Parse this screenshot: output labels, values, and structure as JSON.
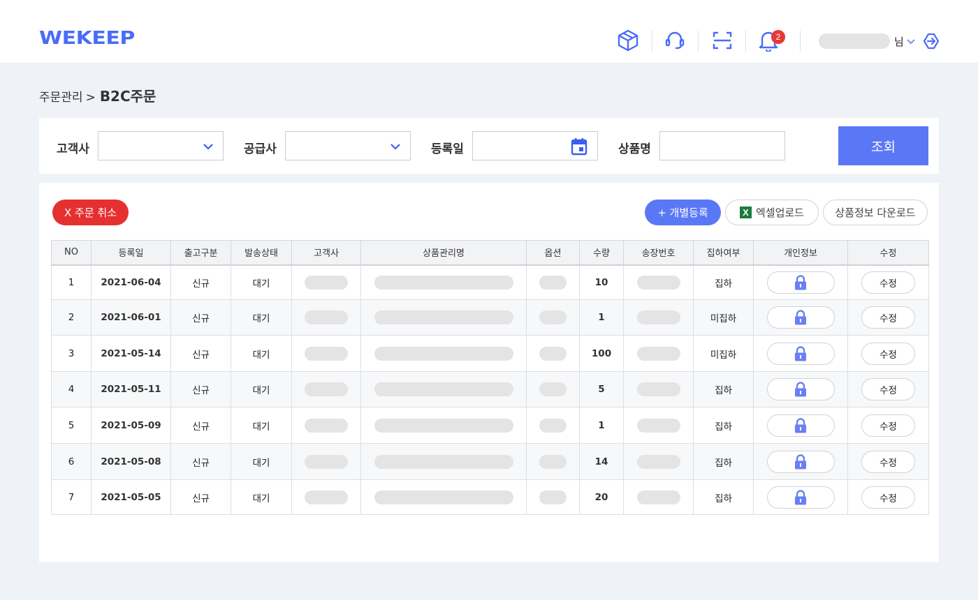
{
  "header": {
    "logo": "WEKEEP",
    "notification_count": "2",
    "user_suffix": "님"
  },
  "breadcrumb": {
    "parent": "주문관리",
    "separator": ">",
    "current": "B2C주문"
  },
  "filter": {
    "customer_label": "고객사",
    "supplier_label": "공급사",
    "date_label": "등록일",
    "product_label": "상품명",
    "search_button": "조회"
  },
  "actions": {
    "cancel_order": "X 주문 취소",
    "add_single": "+ 개별등록",
    "excel_upload": "엑셀업로드",
    "excel_icon": "X",
    "download_product_info": "상품정보 다운로드"
  },
  "table": {
    "columns": [
      "NO",
      "등록일",
      "출고구분",
      "발송상태",
      "고객사",
      "상품관리명",
      "옵션",
      "수량",
      "송장번호",
      "집하여부",
      "개인정보",
      "수정"
    ],
    "rows": [
      {
        "no": "1",
        "date": "2021-06-04",
        "type": "신규",
        "status": "대기",
        "qty": "10",
        "pickup": "집하",
        "edit": "수정"
      },
      {
        "no": "2",
        "date": "2021-06-01",
        "type": "신규",
        "status": "대기",
        "qty": "1",
        "pickup": "미집하",
        "edit": "수정"
      },
      {
        "no": "3",
        "date": "2021-05-14",
        "type": "신규",
        "status": "대기",
        "qty": "100",
        "pickup": "미집하",
        "edit": "수정"
      },
      {
        "no": "4",
        "date": "2021-05-11",
        "type": "신규",
        "status": "대기",
        "qty": "5",
        "pickup": "집하",
        "edit": "수정"
      },
      {
        "no": "5",
        "date": "2021-05-09",
        "type": "신규",
        "status": "대기",
        "qty": "1",
        "pickup": "집하",
        "edit": "수정"
      },
      {
        "no": "6",
        "date": "2021-05-08",
        "type": "신규",
        "status": "대기",
        "qty": "14",
        "pickup": "집하",
        "edit": "수정"
      },
      {
        "no": "7",
        "date": "2021-05-05",
        "type": "신규",
        "status": "대기",
        "qty": "20",
        "pickup": "집하",
        "edit": "수정"
      }
    ]
  },
  "icons": {
    "header": [
      "box-icon",
      "headset-icon",
      "scan-icon",
      "bell-icon",
      "logout-icon"
    ],
    "privacy": "lock-icon"
  },
  "colors": {
    "brand": "#4a6cf7",
    "primary_button": "#5a78f5",
    "danger": "#e53030",
    "excel": "#1d7a3c",
    "background": "#eff2f7"
  }
}
